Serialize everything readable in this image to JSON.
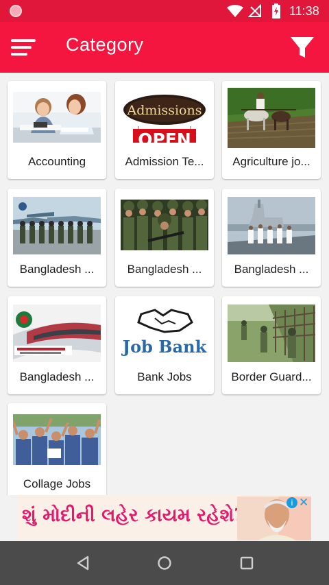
{
  "status_bar": {
    "time": "11:38"
  },
  "app_bar": {
    "title": "Category"
  },
  "categories": [
    {
      "label": "Accounting",
      "image": "office-women-at-desk"
    },
    {
      "label": "Admission Te...",
      "image": "admissions-open-sign",
      "sign_top": "Admissions",
      "sign_bottom": "OPEN"
    },
    {
      "label": "Agriculture jo...",
      "image": "farmer-plowing-with-oxen"
    },
    {
      "label": "Bangladesh ...",
      "image": "air-force-personnel-by-jets"
    },
    {
      "label": "Bangladesh ...",
      "image": "army-soldiers"
    },
    {
      "label": "Bangladesh ...",
      "image": "navy-officers-on-ship"
    },
    {
      "label": "Bangladesh ...",
      "image": "railway-train-logo"
    },
    {
      "label": "Bank Jobs",
      "image": "job-bank-handshake-logo",
      "logo_text": "Job Bank"
    },
    {
      "label": "Border Guard...",
      "image": "border-guards-at-fence"
    },
    {
      "label": "Collage Jobs",
      "image": "students-group-cheering"
    }
  ],
  "ad": {
    "text": "શું મોદીની લહેર કાયમ રહેશે?",
    "info_glyph": "i",
    "close_glyph": "✕"
  },
  "colors": {
    "status_bar": "#e0173a",
    "app_bar": "#f5163f",
    "background": "#f2f2f2",
    "nav_bar": "#4b4b4b"
  }
}
